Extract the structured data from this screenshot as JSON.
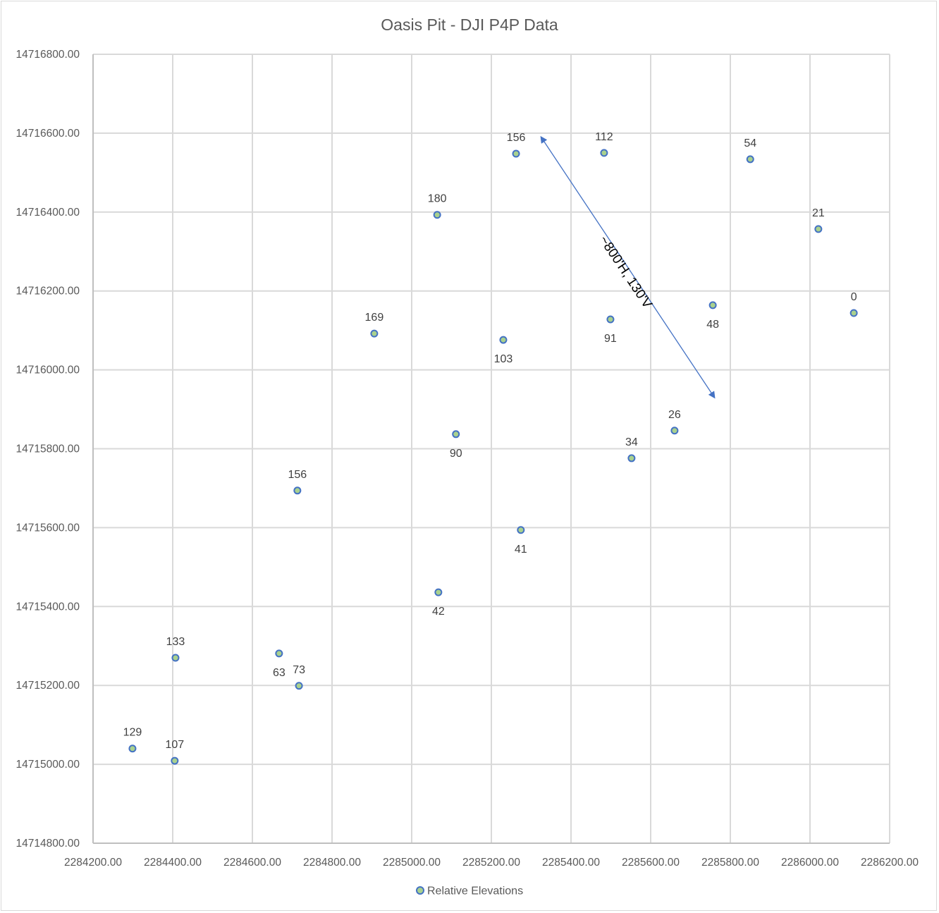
{
  "chart_data": {
    "type": "scatter",
    "title": "Oasis Pit - DJI P4P Data",
    "xlabel": "",
    "ylabel": "",
    "xlim": [
      2284200,
      2286200
    ],
    "ylim": [
      14714800,
      14716800
    ],
    "x_ticks": [
      "2284200.00",
      "2284400.00",
      "2284600.00",
      "2284800.00",
      "2285000.00",
      "2285200.00",
      "2285400.00",
      "2285600.00",
      "2285800.00",
      "2286000.00",
      "2286200.00"
    ],
    "y_ticks": [
      "14714800.00",
      "14715000.00",
      "14715200.00",
      "14715400.00",
      "14715600.00",
      "14715800.00",
      "14716000.00",
      "14716200.00",
      "14716400.00",
      "14716600.00",
      "14716800.00"
    ],
    "x_tick_values": [
      2284200,
      2284400,
      2284600,
      2284800,
      2285000,
      2285200,
      2285400,
      2285600,
      2285800,
      2286000,
      2286200
    ],
    "y_tick_values": [
      14714800,
      14715000,
      14715200,
      14715400,
      14715600,
      14715800,
      14716000,
      14716200,
      14716400,
      14716600,
      14716800
    ],
    "grid": true,
    "legend": {
      "position": "bottom",
      "entries": [
        "Relative Elevations"
      ]
    },
    "series": [
      {
        "name": "Relative Elevations",
        "marker_fill": "#a9d18e",
        "marker_edge": "#4472c4",
        "points": [
          {
            "x": 2285262,
            "y": 14716548,
            "label": "156",
            "label_pos": "above"
          },
          {
            "x": 2285483,
            "y": 14716550,
            "label": "112",
            "label_pos": "above"
          },
          {
            "x": 2285850,
            "y": 14716534,
            "label": "54",
            "label_pos": "above"
          },
          {
            "x": 2285064,
            "y": 14716393,
            "label": "180",
            "label_pos": "above"
          },
          {
            "x": 2286021,
            "y": 14716357,
            "label": "21",
            "label_pos": "above"
          },
          {
            "x": 2286110,
            "y": 14716144,
            "label": "0",
            "label_pos": "above"
          },
          {
            "x": 2285756,
            "y": 14716164,
            "label": "48",
            "label_pos": "below"
          },
          {
            "x": 2285499,
            "y": 14716128,
            "label": "91",
            "label_pos": "below"
          },
          {
            "x": 2284906,
            "y": 14716092,
            "label": "169",
            "label_pos": "above"
          },
          {
            "x": 2285230,
            "y": 14716076,
            "label": "103",
            "label_pos": "below"
          },
          {
            "x": 2285660,
            "y": 14715846,
            "label": "26",
            "label_pos": "above"
          },
          {
            "x": 2285111,
            "y": 14715837,
            "label": "90",
            "label_pos": "below"
          },
          {
            "x": 2285552,
            "y": 14715776,
            "label": "34",
            "label_pos": "above"
          },
          {
            "x": 2284713,
            "y": 14715694,
            "label": "156",
            "label_pos": "above"
          },
          {
            "x": 2285274,
            "y": 14715594,
            "label": "41",
            "label_pos": "below"
          },
          {
            "x": 2285067,
            "y": 14715436,
            "label": "42",
            "label_pos": "below"
          },
          {
            "x": 2284407,
            "y": 14715270,
            "label": "133",
            "label_pos": "above"
          },
          {
            "x": 2284667,
            "y": 14715281,
            "label": "63",
            "label_pos": "below"
          },
          {
            "x": 2284717,
            "y": 14715199,
            "label": "73",
            "label_pos": "above"
          },
          {
            "x": 2284299,
            "y": 14715040,
            "label": "129",
            "label_pos": "above"
          },
          {
            "x": 2284405,
            "y": 14715009,
            "label": "107",
            "label_pos": "above"
          }
        ]
      }
    ],
    "annotations": [
      {
        "type": "double-arrow",
        "from": {
          "x": 2285325,
          "y": 14716590
        },
        "to": {
          "x": 2285760,
          "y": 14715930
        },
        "color": "#4472c4",
        "text": "~800'H, 130'V"
      }
    ]
  }
}
